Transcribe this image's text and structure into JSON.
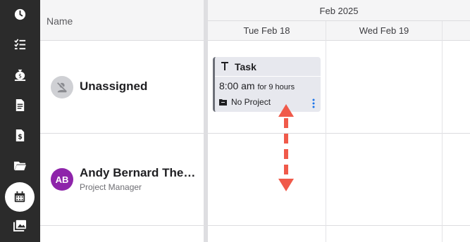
{
  "sidebar": {
    "items": [
      {
        "icon": "clock-icon"
      },
      {
        "icon": "checklist-icon"
      },
      {
        "icon": "money-bag-icon"
      },
      {
        "icon": "document-icon"
      },
      {
        "icon": "invoice-icon"
      },
      {
        "icon": "folder-icon"
      },
      {
        "icon": "calendar-icon",
        "active": true
      },
      {
        "icon": "gallery-icon"
      }
    ]
  },
  "grid": {
    "name_header": "Name",
    "month_header": "Feb 2025",
    "days": [
      "Tue Feb 18",
      "Wed Feb 19"
    ]
  },
  "rows": [
    {
      "label": "Unassigned"
    },
    {
      "initials": "AB",
      "name": "Andy Bernard The…",
      "role": "Project Manager",
      "avatar_color": "#8e24aa"
    }
  ],
  "task": {
    "title": "Task",
    "time": "8:00 am",
    "duration": "for 9 hours",
    "project": "No Project"
  },
  "colors": {
    "sidebar": "#2b2b2b",
    "accent_arrow": "#f05a4a",
    "kebab": "#1a73e8"
  }
}
